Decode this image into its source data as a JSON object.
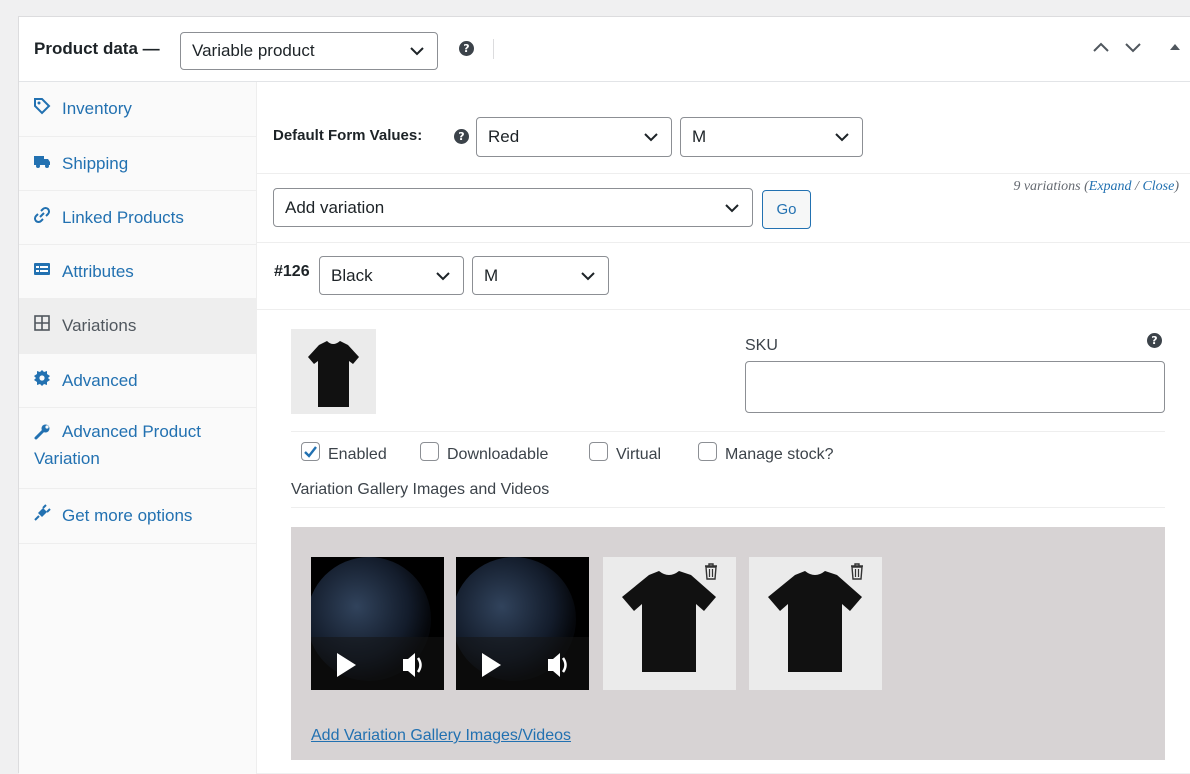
{
  "header": {
    "title": "Product data —",
    "product_type": "Variable product",
    "help": "?"
  },
  "sidebar": {
    "items": [
      {
        "label": "Inventory",
        "icon": "tag-icon"
      },
      {
        "label": "Shipping",
        "icon": "truck-icon"
      },
      {
        "label": "Linked Products",
        "icon": "link-icon"
      },
      {
        "label": "Attributes",
        "icon": "list-icon"
      },
      {
        "label": "Variations",
        "icon": "grid-icon"
      },
      {
        "label": "Advanced",
        "icon": "gear-icon"
      },
      {
        "label": "Advanced Product Variation",
        "icon": "wrench-icon"
      },
      {
        "label": "Get more options",
        "icon": "plugin-icon"
      }
    ],
    "active": "Variations"
  },
  "defaults": {
    "label": "Default Form Values:",
    "color": "Red",
    "size": "M"
  },
  "actions": {
    "select": "Add variation",
    "go": "Go",
    "count_text": "9 variations (",
    "expand": "Expand",
    "sep": " / ",
    "close": "Close",
    "end": ")"
  },
  "variation": {
    "id": "#126",
    "color": "Black",
    "size": "M",
    "sku_label": "SKU",
    "sku_value": "",
    "options": [
      {
        "label": "Enabled",
        "checked": true
      },
      {
        "label": "Downloadable",
        "checked": false
      },
      {
        "label": "Virtual",
        "checked": false
      },
      {
        "label": "Manage stock?",
        "checked": false
      }
    ],
    "gallery_title": "Variation Gallery Images and Videos",
    "gallery_items": [
      "video",
      "video",
      "image",
      "image"
    ],
    "gallery_link": "Add Variation Gallery Images/Videos"
  },
  "colors": {
    "accent": "#2271b1",
    "gallery_bg": "#d7d3d4"
  }
}
